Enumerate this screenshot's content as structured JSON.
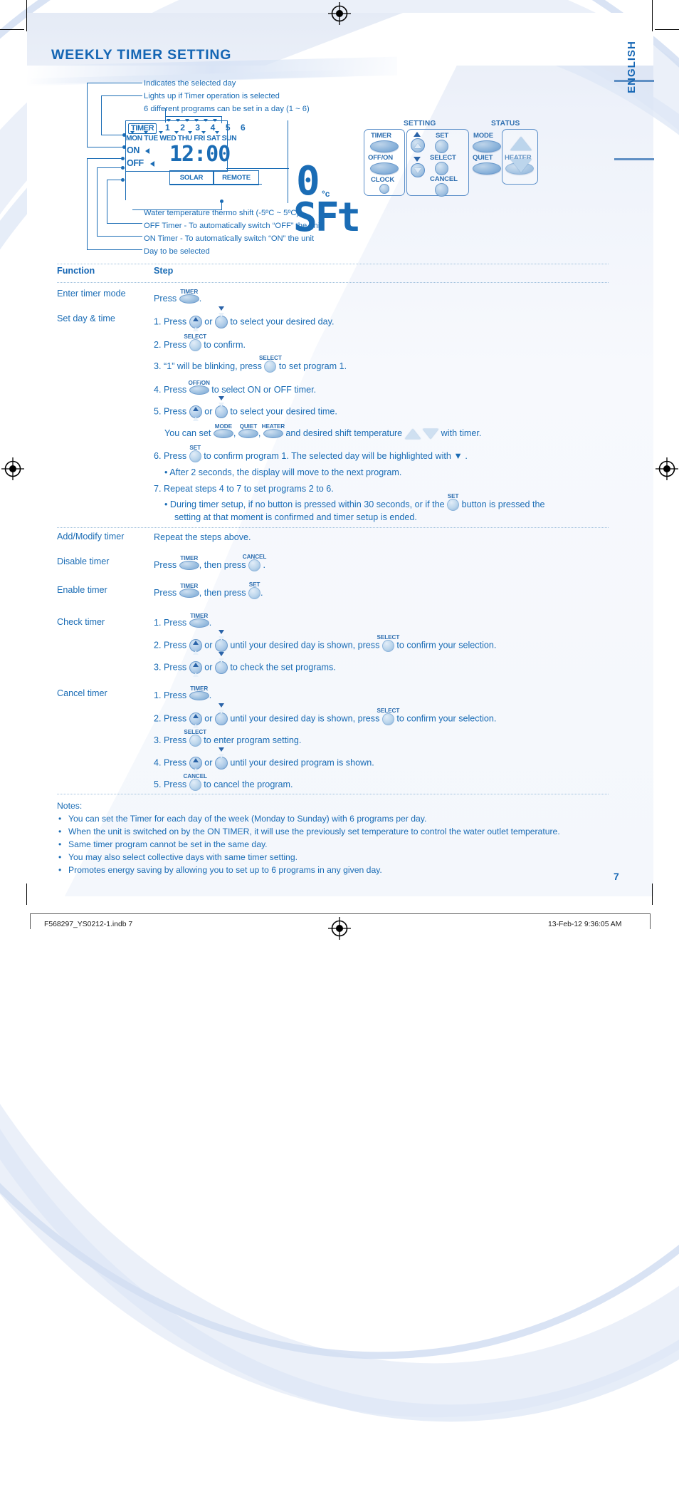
{
  "page": {
    "title": "WEEKLY TIMER SETTING",
    "language_tab": "ENGLISH",
    "page_number": "7",
    "accent_color": "#1566b4",
    "text_color": "#1a6cb5",
    "button_color": "#8fb6dc"
  },
  "diagram": {
    "callouts_top": [
      "Indicates the selected day",
      "Lights up if Timer operation is selected",
      "6 different programs can be set in a day (1 ~ 6)"
    ],
    "callouts_bottom": [
      "Water temperature thermo shift (-5ºC ~ 5ºC)",
      "OFF Timer - To automatically switch “OFF” the unit",
      "ON Timer - To automatically switch “ON” the unit",
      "Day to be selected"
    ],
    "lcd": {
      "timer_badge": "TIMER",
      "program_numbers": "1 2 3 4 5 6",
      "days": [
        "MON",
        "TUE",
        "WED",
        "THU",
        "FRI",
        "SAT",
        "SUN"
      ],
      "on_label": "ON",
      "off_label": "OFF",
      "clock": "12:00",
      "solar": "SOLAR",
      "remote": "REMOTE",
      "temp_value": "0",
      "temp_unit": "°c",
      "shift_code": "SFt"
    }
  },
  "remote": {
    "headers": {
      "setting": "SETTING",
      "status": "STATUS"
    },
    "buttons": {
      "timer": "TIMER",
      "off_on": "OFF/ON",
      "clock": "CLOCK",
      "set": "SET",
      "select": "SELECT",
      "cancel": "CANCEL",
      "mode": "MODE",
      "quiet": "QUIET",
      "heater": "HEATER"
    }
  },
  "table": {
    "headers": {
      "function": "Function",
      "step": "Step"
    },
    "rows": [
      {
        "function": "Enter timer mode",
        "lines": [
          {
            "pre": "Press ",
            "glyph": "timer-oval",
            "post": "."
          }
        ]
      },
      {
        "function": "Set day & time",
        "lines": [
          {
            "pre": "1. Press ",
            "glyph": "up-arrow-btn",
            "mid": " or ",
            "glyph2": "down-arrow-btn",
            "post": " to select your desired day."
          },
          {
            "pre": "2. Press ",
            "glyph": "select-round",
            "post": "  to confirm."
          },
          {
            "pre": "3. “1” will be blinking, press ",
            "glyph": "select-round",
            "post": "  to set program 1."
          },
          {
            "pre": "4. Press ",
            "glyph": "offon-oval",
            "post": " to select ON or OFF timer."
          },
          {
            "pre": "5. Press ",
            "glyph": "up-arrow-btn",
            "mid": " or ",
            "glyph2": "down-arrow-btn",
            "post": " to select your desired time."
          },
          {
            "pre": "You can set ",
            "glyph": "mode-oval",
            "mid": ", ",
            "glyph2": "quiet-oval",
            "mid2": ", ",
            "glyph3": "heater-oval",
            "post": " and desired shift temperature ",
            "post2": " with timer."
          },
          {
            "pre": "6. Press ",
            "glyph": "set-round",
            "post": " to confirm program 1. The selected day will be highlighted with ▼ ."
          },
          {
            "pre": "•  After 2 seconds, the display will move to the next program."
          },
          {
            "pre": "7. Repeat steps 4 to 7 to set programs 2 to 6."
          },
          {
            "pre": "•  During timer setup, if no button is pressed within 30 seconds, or if the ",
            "glyph": "set-round",
            "post": " button is pressed the"
          },
          {
            "pre": "setting at that moment is confirmed and timer setup is ended."
          }
        ]
      },
      {
        "function": "Add/Modify timer",
        "lines": [
          {
            "pre": "Repeat the steps above."
          }
        ]
      },
      {
        "function": "Disable timer",
        "lines": [
          {
            "pre": "Press ",
            "glyph": "timer-oval",
            "mid": ", then press ",
            "glyph2": "cancel-round",
            "post": " ."
          }
        ]
      },
      {
        "function": "Enable timer",
        "lines": [
          {
            "pre": "Press ",
            "glyph": "timer-oval",
            "mid": ", then press ",
            "glyph2": "set-round",
            "post": "."
          }
        ]
      },
      {
        "function": "Check timer",
        "lines": [
          {
            "pre": "1. Press ",
            "glyph": "timer-oval",
            "post": "."
          },
          {
            "pre": "2. Press ",
            "glyph": "up-arrow-btn",
            "mid": " or ",
            "glyph2": "down-arrow-btn",
            "post": " until your desired day is shown, press ",
            "glyph3": "select-round",
            "post2": "  to confirm your selection."
          },
          {
            "pre": "3. Press ",
            "glyph": "up-arrow-btn",
            "mid": " or ",
            "glyph2": "down-arrow-btn",
            "post": " to check the set programs."
          }
        ]
      },
      {
        "function": "Cancel timer",
        "lines": [
          {
            "pre": "1. Press ",
            "glyph": "timer-oval",
            "post": "."
          },
          {
            "pre": "2. Press ",
            "glyph": "up-arrow-btn",
            "mid": " or ",
            "glyph2": "down-arrow-btn",
            "post": " until your desired day is shown, press ",
            "glyph3": "select-round",
            "post2": "  to confirm your selection."
          },
          {
            "pre": "3. Press ",
            "glyph": "select-round",
            "post": "  to enter program setting."
          },
          {
            "pre": "4. Press ",
            "glyph": "up-arrow-btn",
            "mid": " or ",
            "glyph2": "down-arrow-btn",
            "post": " until your desired program is shown."
          },
          {
            "pre": "5. Press ",
            "glyph": "cancel-round",
            "post": "  to cancel the program."
          }
        ]
      }
    ]
  },
  "notes": {
    "title": "Notes:",
    "items": [
      "You can set the Timer for each day of the week (Monday to Sunday) with 6 programs per day.",
      "When the unit is switched on by the ON TIMER, it will use the previously set temperature to control the water outlet temperature.",
      "Same timer program cannot be set in the same day.",
      "You may also select collective days with same timer setting.",
      "Promotes energy saving by allowing you to set up to 6 programs in any given day."
    ]
  },
  "footer": {
    "filename": "F568297_YS0212-1.indb   7",
    "timestamp": "13-Feb-12   9:36:05 AM"
  }
}
